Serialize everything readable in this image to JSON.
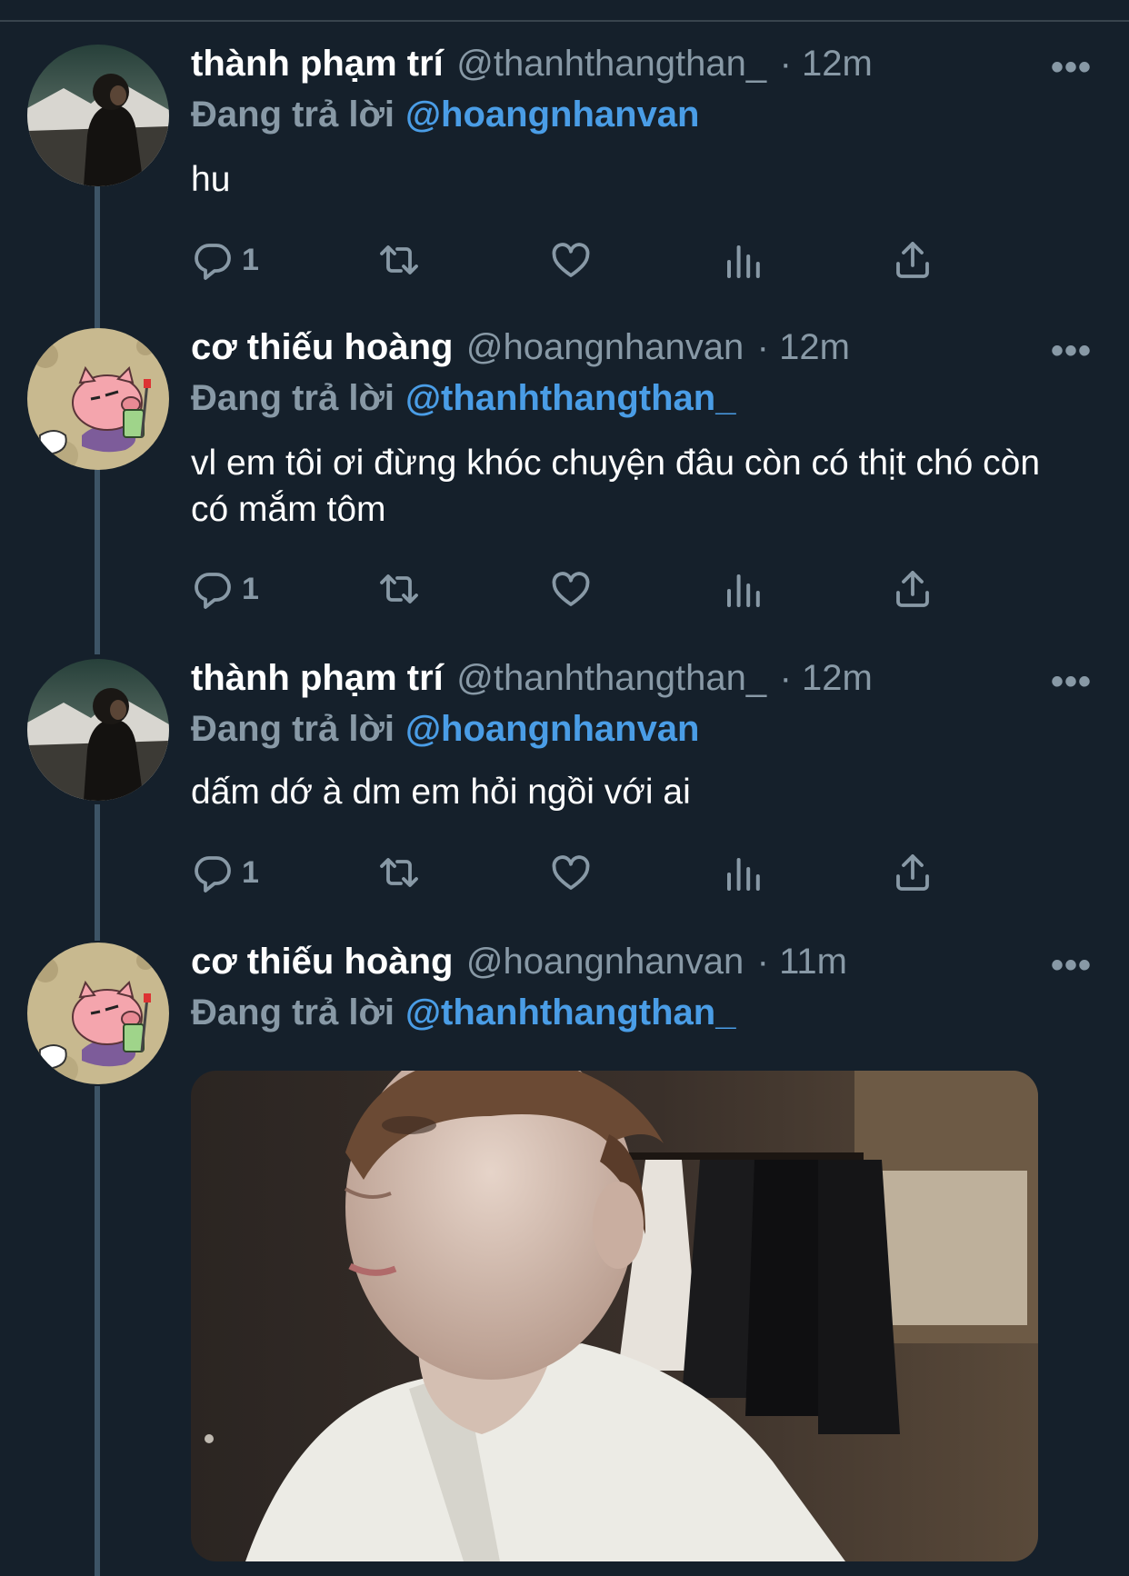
{
  "timeline": {
    "tweets": [
      {
        "name": "thành phạm trí",
        "handle": "@thanhthangthan_",
        "time": "· 12m",
        "replying_prefix": "Đang trả lời",
        "replying_to": "@hoangnhanvan",
        "text": "hu",
        "reply_count": "1",
        "avatar": "photo-avatar"
      },
      {
        "name": "cơ thiếu hoàng",
        "handle": "@hoangnhanvan",
        "time": "· 12m",
        "replying_prefix": "Đang trả lời",
        "replying_to": "@thanhthangthan_",
        "text": "vl em tôi ơi đừng khóc chuyện đâu còn có thịt chó còn có mắm tôm",
        "reply_count": "1",
        "avatar": "pig-cartoon-avatar"
      },
      {
        "name": "thành phạm trí",
        "handle": "@thanhthangthan_",
        "time": "· 12m",
        "replying_prefix": "Đang trả lời",
        "replying_to": "@hoangnhanvan",
        "text": "dấm dớ à dm em hỏi ngồi với ai",
        "reply_count": "1",
        "avatar": "photo-avatar"
      },
      {
        "name": "cơ thiếu hoàng",
        "handle": "@hoangnhanvan",
        "time": "· 11m",
        "replying_prefix": "Đang trả lời",
        "replying_to": "@thanhthangthan_",
        "avatar": "pig-cartoon-avatar",
        "media": "photo-attachment"
      }
    ],
    "more_glyph": "•••",
    "icons": [
      "reply-icon",
      "retweet-icon",
      "like-icon",
      "analytics-icon",
      "share-icon",
      "more-icon"
    ]
  },
  "colors": {
    "background": "#15202b",
    "text_primary": "#ffffff",
    "text_secondary": "#8899a6",
    "mention": "#4a9de6",
    "thread_line": "#3d5466"
  }
}
